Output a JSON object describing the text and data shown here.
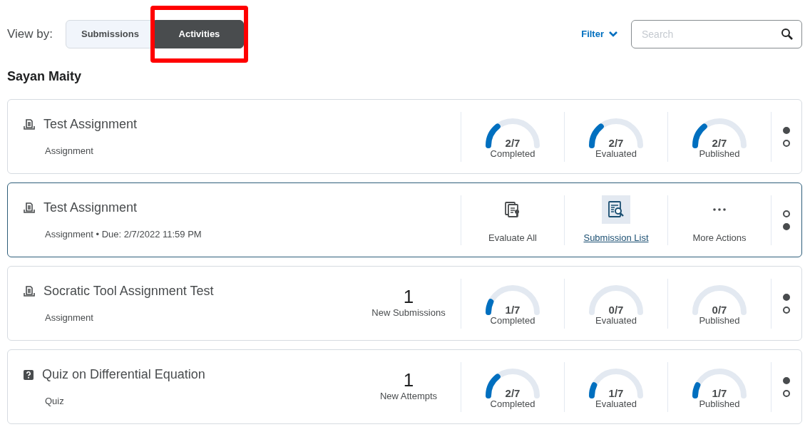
{
  "view_by": {
    "label": "View by:",
    "tabs": [
      {
        "label": "Submissions",
        "selected": false,
        "highlighted": false
      },
      {
        "label": "Activities",
        "selected": true,
        "highlighted": true
      }
    ]
  },
  "filter": {
    "label": "Filter"
  },
  "search": {
    "placeholder": "Search"
  },
  "group_title": "Sayan Maity",
  "activities": [
    {
      "kind": "assignment",
      "title": "Test Assignment",
      "subtitle": "Assignment",
      "focused": false,
      "gauges": [
        {
          "reading": "2/7",
          "label": "Completed"
        },
        {
          "reading": "2/7",
          "label": "Evaluated"
        },
        {
          "reading": "2/7",
          "label": "Published"
        }
      ],
      "pages": [
        {
          "selected": true
        },
        {
          "selected": false
        }
      ]
    },
    {
      "kind": "assignment",
      "title": "Test Assignment",
      "subtitle": "Assignment • Due: 2/7/2022 11:59 PM",
      "focused": true,
      "actions": [
        {
          "kind": "evaluate",
          "label": "Evaluate All"
        },
        {
          "kind": "list",
          "label": "Submission List"
        },
        {
          "kind": "more",
          "label": "More Actions"
        }
      ],
      "pages": [
        {
          "selected": false
        },
        {
          "selected": true
        }
      ]
    },
    {
      "kind": "assignment",
      "title": "Socratic Tool Assignment Test",
      "subtitle": "Assignment",
      "focused": false,
      "new_count": {
        "value": "1",
        "label": "New Submissions"
      },
      "gauges": [
        {
          "reading": "1/7",
          "label": "Completed"
        },
        {
          "reading": "0/7",
          "label": "Evaluated"
        },
        {
          "reading": "0/7",
          "label": "Published"
        }
      ],
      "pages": [
        {
          "selected": true
        },
        {
          "selected": false
        }
      ]
    },
    {
      "kind": "quiz",
      "title": "Quiz on Differential Equation",
      "subtitle": "Quiz",
      "focused": false,
      "new_count": {
        "value": "1",
        "label": "New Attempts"
      },
      "gauges": [
        {
          "reading": "2/7",
          "label": "Completed"
        },
        {
          "reading": "1/7",
          "label": "Evaluated"
        },
        {
          "reading": "1/7",
          "label": "Published"
        }
      ],
      "pages": [
        {
          "selected": true
        },
        {
          "selected": false
        }
      ]
    }
  ]
}
